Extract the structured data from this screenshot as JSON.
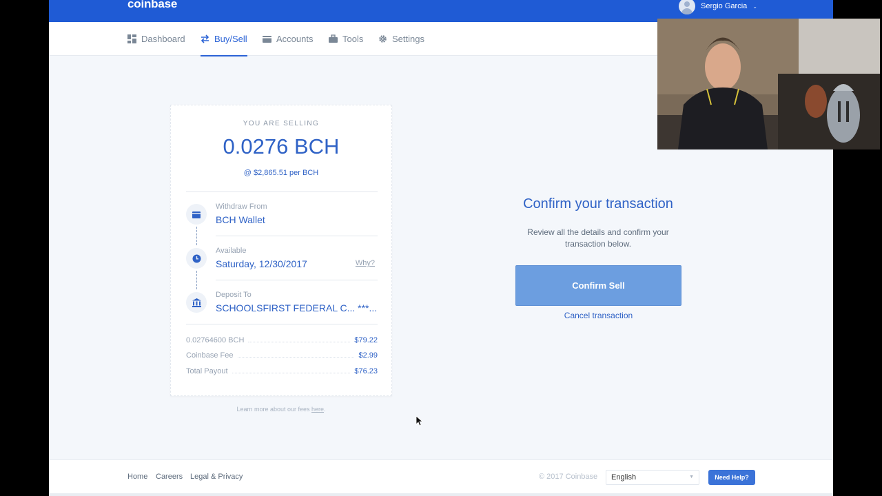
{
  "header": {
    "logo": "coinbase",
    "user_name": "Sergio Garcia",
    "user_chevron": "⌄"
  },
  "nav": {
    "items": [
      {
        "label": "Dashboard",
        "icon": "dashboard-icon"
      },
      {
        "label": "Buy/Sell",
        "icon": "exchange-icon",
        "active": true
      },
      {
        "label": "Accounts",
        "icon": "wallet-icon"
      },
      {
        "label": "Tools",
        "icon": "toolbox-icon"
      },
      {
        "label": "Settings",
        "icon": "gear-icon"
      }
    ]
  },
  "card": {
    "eyebrow": "YOU ARE SELLING",
    "amount": "0.0276 BCH",
    "rate": "@ $2,865.51 per BCH",
    "withdraw_label": "Withdraw From",
    "withdraw_value": "BCH Wallet",
    "available_label": "Available",
    "available_value": "Saturday, 12/30/2017",
    "why_link": "Why?",
    "deposit_label": "Deposit To",
    "deposit_value": "SCHOOLSFIRST FEDERAL C... ***...",
    "summary": [
      {
        "label": "0.02764600 BCH",
        "value": "$79.22"
      },
      {
        "label": "Coinbase Fee",
        "value": "$2.99"
      },
      {
        "label": "Total Payout",
        "value": "$76.23"
      }
    ]
  },
  "fees_note": {
    "prefix": "Learn more about our fees ",
    "link": "here",
    "suffix": "."
  },
  "confirm": {
    "title": "Confirm your transaction",
    "description": "Review all the details and confirm your transaction below.",
    "button": "Confirm Sell",
    "cancel": "Cancel transaction"
  },
  "footer": {
    "links": [
      "Home",
      "Careers",
      "Legal & Privacy"
    ],
    "copyright": "© 2017 Coinbase",
    "language": "English",
    "help_button": "Need Help?"
  },
  "colors": {
    "brand_blue": "#1f5bd5",
    "accent": "#2f62c6",
    "confirm_button": "#6c9ee0"
  }
}
